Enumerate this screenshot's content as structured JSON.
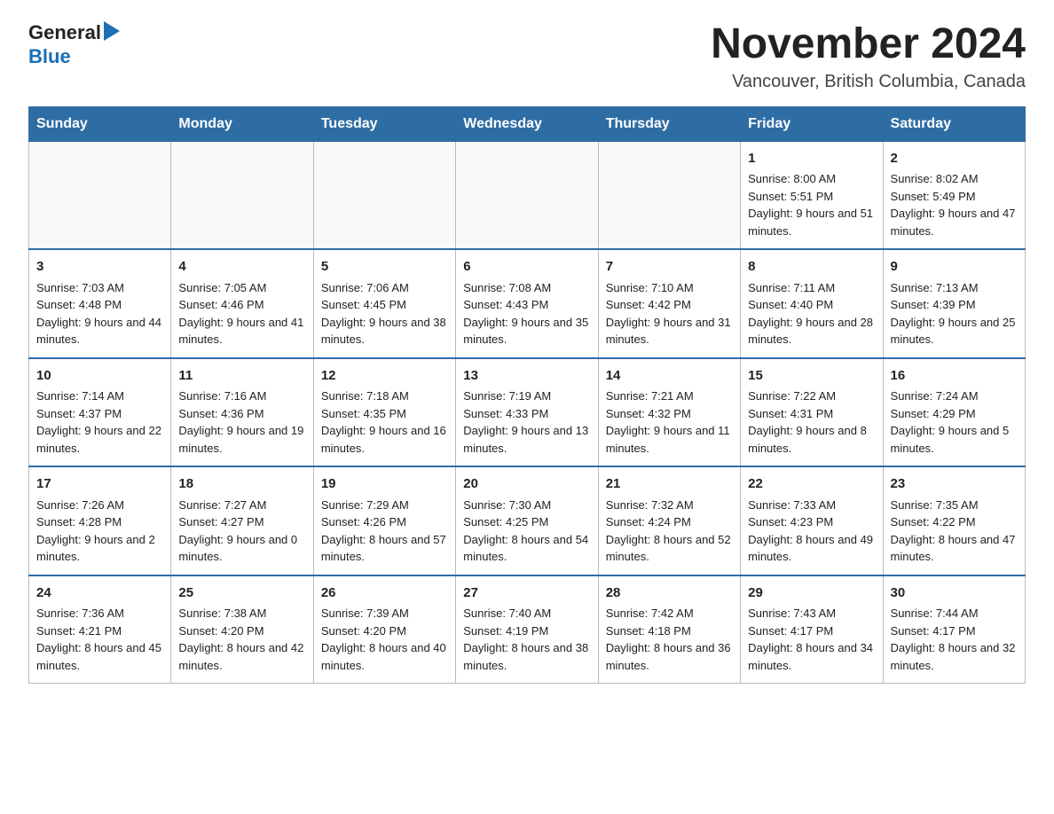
{
  "logo": {
    "text_general": "General",
    "text_blue": "Blue",
    "triangle_char": "▶"
  },
  "header": {
    "month_year": "November 2024",
    "location": "Vancouver, British Columbia, Canada"
  },
  "weekdays": [
    "Sunday",
    "Monday",
    "Tuesday",
    "Wednesday",
    "Thursday",
    "Friday",
    "Saturday"
  ],
  "rows": [
    {
      "cells": [
        {
          "day": "",
          "info": ""
        },
        {
          "day": "",
          "info": ""
        },
        {
          "day": "",
          "info": ""
        },
        {
          "day": "",
          "info": ""
        },
        {
          "day": "",
          "info": ""
        },
        {
          "day": "1",
          "info": "Sunrise: 8:00 AM\nSunset: 5:51 PM\nDaylight: 9 hours and 51 minutes."
        },
        {
          "day": "2",
          "info": "Sunrise: 8:02 AM\nSunset: 5:49 PM\nDaylight: 9 hours and 47 minutes."
        }
      ]
    },
    {
      "cells": [
        {
          "day": "3",
          "info": "Sunrise: 7:03 AM\nSunset: 4:48 PM\nDaylight: 9 hours and 44 minutes."
        },
        {
          "day": "4",
          "info": "Sunrise: 7:05 AM\nSunset: 4:46 PM\nDaylight: 9 hours and 41 minutes."
        },
        {
          "day": "5",
          "info": "Sunrise: 7:06 AM\nSunset: 4:45 PM\nDaylight: 9 hours and 38 minutes."
        },
        {
          "day": "6",
          "info": "Sunrise: 7:08 AM\nSunset: 4:43 PM\nDaylight: 9 hours and 35 minutes."
        },
        {
          "day": "7",
          "info": "Sunrise: 7:10 AM\nSunset: 4:42 PM\nDaylight: 9 hours and 31 minutes."
        },
        {
          "day": "8",
          "info": "Sunrise: 7:11 AM\nSunset: 4:40 PM\nDaylight: 9 hours and 28 minutes."
        },
        {
          "day": "9",
          "info": "Sunrise: 7:13 AM\nSunset: 4:39 PM\nDaylight: 9 hours and 25 minutes."
        }
      ]
    },
    {
      "cells": [
        {
          "day": "10",
          "info": "Sunrise: 7:14 AM\nSunset: 4:37 PM\nDaylight: 9 hours and 22 minutes."
        },
        {
          "day": "11",
          "info": "Sunrise: 7:16 AM\nSunset: 4:36 PM\nDaylight: 9 hours and 19 minutes."
        },
        {
          "day": "12",
          "info": "Sunrise: 7:18 AM\nSunset: 4:35 PM\nDaylight: 9 hours and 16 minutes."
        },
        {
          "day": "13",
          "info": "Sunrise: 7:19 AM\nSunset: 4:33 PM\nDaylight: 9 hours and 13 minutes."
        },
        {
          "day": "14",
          "info": "Sunrise: 7:21 AM\nSunset: 4:32 PM\nDaylight: 9 hours and 11 minutes."
        },
        {
          "day": "15",
          "info": "Sunrise: 7:22 AM\nSunset: 4:31 PM\nDaylight: 9 hours and 8 minutes."
        },
        {
          "day": "16",
          "info": "Sunrise: 7:24 AM\nSunset: 4:29 PM\nDaylight: 9 hours and 5 minutes."
        }
      ]
    },
    {
      "cells": [
        {
          "day": "17",
          "info": "Sunrise: 7:26 AM\nSunset: 4:28 PM\nDaylight: 9 hours and 2 minutes."
        },
        {
          "day": "18",
          "info": "Sunrise: 7:27 AM\nSunset: 4:27 PM\nDaylight: 9 hours and 0 minutes."
        },
        {
          "day": "19",
          "info": "Sunrise: 7:29 AM\nSunset: 4:26 PM\nDaylight: 8 hours and 57 minutes."
        },
        {
          "day": "20",
          "info": "Sunrise: 7:30 AM\nSunset: 4:25 PM\nDaylight: 8 hours and 54 minutes."
        },
        {
          "day": "21",
          "info": "Sunrise: 7:32 AM\nSunset: 4:24 PM\nDaylight: 8 hours and 52 minutes."
        },
        {
          "day": "22",
          "info": "Sunrise: 7:33 AM\nSunset: 4:23 PM\nDaylight: 8 hours and 49 minutes."
        },
        {
          "day": "23",
          "info": "Sunrise: 7:35 AM\nSunset: 4:22 PM\nDaylight: 8 hours and 47 minutes."
        }
      ]
    },
    {
      "cells": [
        {
          "day": "24",
          "info": "Sunrise: 7:36 AM\nSunset: 4:21 PM\nDaylight: 8 hours and 45 minutes."
        },
        {
          "day": "25",
          "info": "Sunrise: 7:38 AM\nSunset: 4:20 PM\nDaylight: 8 hours and 42 minutes."
        },
        {
          "day": "26",
          "info": "Sunrise: 7:39 AM\nSunset: 4:20 PM\nDaylight: 8 hours and 40 minutes."
        },
        {
          "day": "27",
          "info": "Sunrise: 7:40 AM\nSunset: 4:19 PM\nDaylight: 8 hours and 38 minutes."
        },
        {
          "day": "28",
          "info": "Sunrise: 7:42 AM\nSunset: 4:18 PM\nDaylight: 8 hours and 36 minutes."
        },
        {
          "day": "29",
          "info": "Sunrise: 7:43 AM\nSunset: 4:17 PM\nDaylight: 8 hours and 34 minutes."
        },
        {
          "day": "30",
          "info": "Sunrise: 7:44 AM\nSunset: 4:17 PM\nDaylight: 8 hours and 32 minutes."
        }
      ]
    }
  ]
}
